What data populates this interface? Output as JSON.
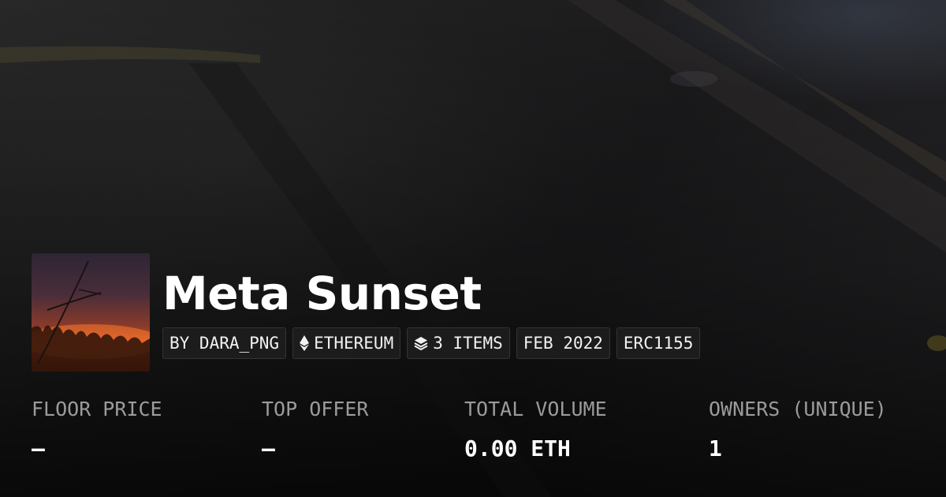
{
  "collection": {
    "title": "Meta Sunset",
    "thumbnail_icon": "sunset-grass-image"
  },
  "tags": {
    "creator": "BY DARA_PNG",
    "chain": "ETHEREUM",
    "chain_icon": "ethereum-icon",
    "items": "3 ITEMS",
    "items_icon": "layers-icon",
    "date": "FEB 2022",
    "standard": "ERC1155"
  },
  "stats": {
    "floor_price": {
      "label": "FLOOR PRICE",
      "value": "—"
    },
    "top_offer": {
      "label": "TOP OFFER",
      "value": "—"
    },
    "total_volume": {
      "label": "TOTAL VOLUME",
      "value": "0.00 ETH"
    },
    "owners": {
      "label": "OWNERS (UNIQUE)",
      "value": "1"
    }
  },
  "colors": {
    "text_primary": "#ffffff",
    "text_muted": "#9b9b9b",
    "tag_background": "#1e1e1e"
  }
}
